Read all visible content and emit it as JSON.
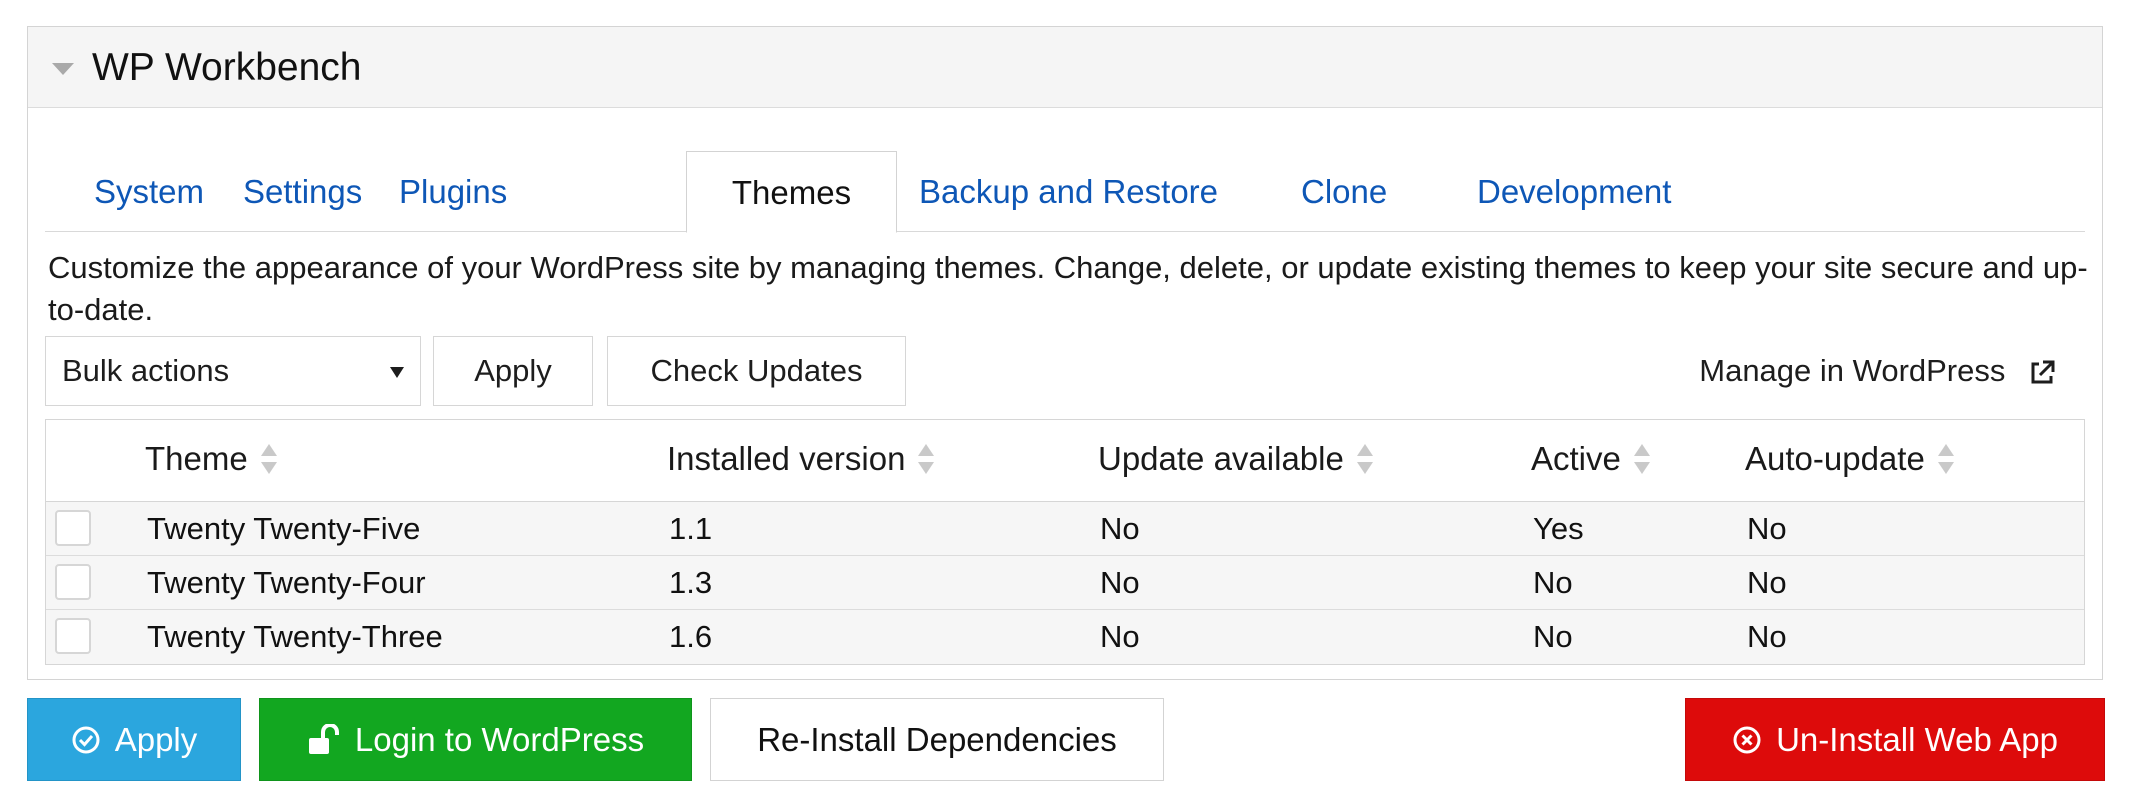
{
  "panel": {
    "title": "WP Workbench"
  },
  "tabs": [
    {
      "label": "System",
      "active": false
    },
    {
      "label": "Settings",
      "active": false
    },
    {
      "label": "Plugins",
      "active": false
    },
    {
      "label": "Themes",
      "active": true
    },
    {
      "label": "Backup and Restore",
      "active": false
    },
    {
      "label": "Clone",
      "active": false
    },
    {
      "label": "Development",
      "active": false
    }
  ],
  "description": "Customize the appearance of your WordPress site by managing themes. Change, delete, or update existing themes to keep your site secure and up-to-date.",
  "toolbar": {
    "bulk_actions_selected": "Bulk actions",
    "apply_label": "Apply",
    "check_updates_label": "Check Updates",
    "manage_link_label": "Manage in WordPress"
  },
  "table": {
    "columns": [
      "Theme",
      "Installed version",
      "Update available",
      "Active",
      "Auto-update"
    ],
    "rows": [
      {
        "theme": "Twenty Twenty-Five",
        "installed_version": "1.1",
        "update_available": "No",
        "active": "Yes",
        "auto_update": "No"
      },
      {
        "theme": "Twenty Twenty-Four",
        "installed_version": "1.3",
        "update_available": "No",
        "active": "No",
        "auto_update": "No"
      },
      {
        "theme": "Twenty Twenty-Three",
        "installed_version": "1.6",
        "update_available": "No",
        "active": "No",
        "auto_update": "No"
      }
    ]
  },
  "footer": {
    "apply_label": "Apply",
    "login_label": "Login to WordPress",
    "reinstall_label": "Re-Install Dependencies",
    "uninstall_label": "Un-Install Web App"
  },
  "colors": {
    "link_blue": "#0e57b6",
    "apply_blue": "#2ba6de",
    "login_green": "#12a720",
    "uninstall_red": "#dd0b0b"
  },
  "icons": {
    "collapse": "caret-down-icon",
    "sort": "sort-icon",
    "external_link": "external-link-icon",
    "apply": "check-circle-icon",
    "login": "unlock-icon",
    "uninstall": "times-circle-icon"
  }
}
